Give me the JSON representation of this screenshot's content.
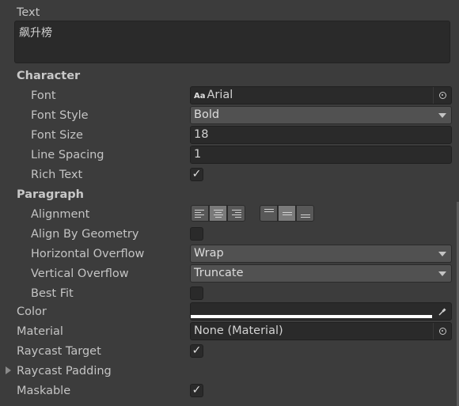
{
  "text": {
    "label": "Text",
    "value": "飙升榜"
  },
  "character": {
    "header": "Character",
    "font": {
      "label": "Font",
      "icon_text": "Aa",
      "value": "Arial"
    },
    "font_style": {
      "label": "Font Style",
      "value": "Bold"
    },
    "font_size": {
      "label": "Font Size",
      "value": "18"
    },
    "line_spacing": {
      "label": "Line Spacing",
      "value": "1"
    },
    "rich_text": {
      "label": "Rich Text",
      "checked": true,
      "mark": "✓"
    }
  },
  "paragraph": {
    "header": "Paragraph",
    "alignment": {
      "label": "Alignment",
      "horizontal_selected": "center",
      "vertical_selected": "middle"
    },
    "align_by_geometry": {
      "label": "Align By Geometry",
      "checked": false
    },
    "horizontal_overflow": {
      "label": "Horizontal Overflow",
      "value": "Wrap"
    },
    "vertical_overflow": {
      "label": "Vertical Overflow",
      "value": "Truncate"
    },
    "best_fit": {
      "label": "Best Fit",
      "checked": false
    }
  },
  "color": {
    "label": "Color",
    "value": "#FFFFFF"
  },
  "material": {
    "label": "Material",
    "value": "None (Material)"
  },
  "raycast_target": {
    "label": "Raycast Target",
    "checked": true,
    "mark": "✓"
  },
  "raycast_padding": {
    "label": "Raycast Padding",
    "expanded": false
  },
  "maskable": {
    "label": "Maskable",
    "checked": true,
    "mark": "✓"
  }
}
